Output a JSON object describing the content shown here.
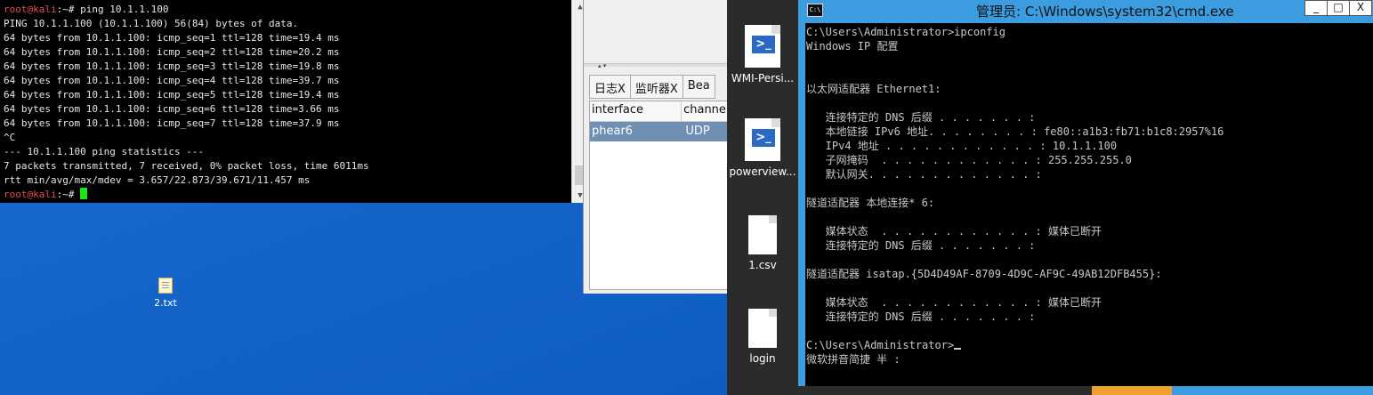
{
  "kali_terminal": {
    "prompt_user": "root@kali",
    "prompt_path": ":~#",
    "command": " ping 10.1.1.100",
    "output": [
      "PING 10.1.1.100 (10.1.1.100) 56(84) bytes of data.",
      "64 bytes from 10.1.1.100: icmp_seq=1 ttl=128 time=19.4 ms",
      "64 bytes from 10.1.1.100: icmp_seq=2 ttl=128 time=20.2 ms",
      "64 bytes from 10.1.1.100: icmp_seq=3 ttl=128 time=19.8 ms",
      "64 bytes from 10.1.1.100: icmp_seq=4 ttl=128 time=39.7 ms",
      "64 bytes from 10.1.1.100: icmp_seq=5 ttl=128 time=19.4 ms",
      "64 bytes from 10.1.1.100: icmp_seq=6 ttl=128 time=3.66 ms",
      "64 bytes from 10.1.1.100: icmp_seq=7 ttl=128 time=37.9 ms",
      "^C",
      "--- 10.1.1.100 ping statistics ---",
      "7 packets transmitted, 7 received, 0% packet loss, time 6011ms",
      "rtt min/avg/max/mdev = 3.657/22.873/39.671/11.457 ms"
    ],
    "final_prompt_user": "root@kali",
    "final_prompt_path": ":~#"
  },
  "mid_window": {
    "tabs": [
      "日志X",
      "监听器X",
      "Bea"
    ],
    "columns": [
      "interface",
      "channe"
    ],
    "rows": [
      [
        "phear6",
        "UDP"
      ]
    ]
  },
  "desktop_strip_icons": [
    {
      "label": "WMI-Persi...",
      "icon": "powershell-script-icon"
    },
    {
      "label": "powerview...",
      "icon": "powershell-script-icon"
    },
    {
      "label": "1.csv",
      "icon": "document-icon"
    },
    {
      "label": "login",
      "icon": "document-icon"
    }
  ],
  "cmd_window": {
    "title": "管理员: C:\\Windows\\system32\\cmd.exe",
    "icon_text": "C:\\",
    "controls": {
      "minimize": "_",
      "maximize": "□",
      "close": "X"
    },
    "lines": [
      "C:\\Users\\Administrator>ipconfig",
      "",
      "Windows IP 配置",
      "",
      "",
      "以太网适配器 Ethernet1:",
      "",
      "   连接特定的 DNS 后缀 . . . . . . . :",
      "   本地链接 IPv6 地址. . . . . . . . : fe80::a1b3:fb71:b1c8:2957%16",
      "   IPv4 地址 . . . . . . . . . . . . : 10.1.1.100",
      "   子网掩码  . . . . . . . . . . . . : 255.255.255.0",
      "   默认网关. . . . . . . . . . . . . :",
      "",
      "隧道适配器 本地连接* 6:",
      "",
      "   媒体状态  . . . . . . . . . . . . : 媒体已断开",
      "   连接特定的 DNS 后缀 . . . . . . . :",
      "",
      "隧道适配器 isatap.{5D4D49AF-8709-4D9C-AF9C-49AB12DFB455}:",
      "",
      "   媒体状态  . . . . . . . . . . . . : 媒体已断开",
      "   连接特定的 DNS 后缀 . . . . . . . :",
      "",
      "C:\\Users\\Administrator>"
    ],
    "ime_status": "微软拼音简捷 半 :"
  },
  "desktop_file": {
    "label": "2.txt",
    "icon": "text-file-icon"
  }
}
